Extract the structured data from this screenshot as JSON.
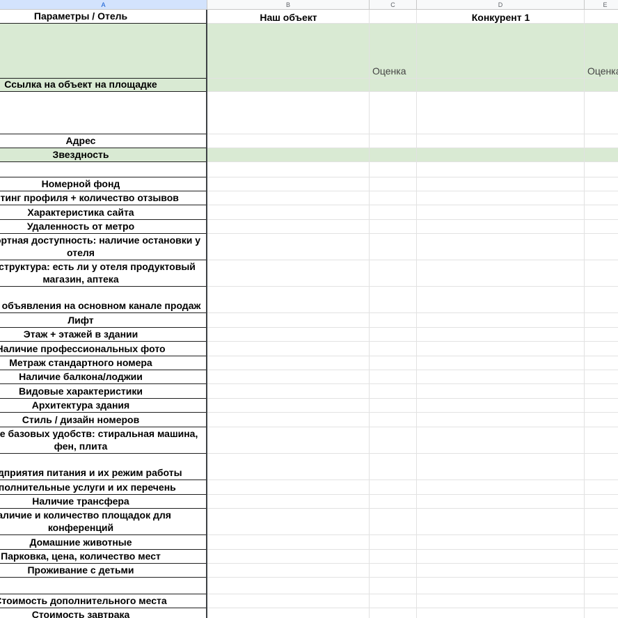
{
  "columns": [
    "A",
    "B",
    "C",
    "D",
    "E"
  ],
  "headers": {
    "our": "Наш объект",
    "competitor1": "Конкурент 1"
  },
  "score_label": "Оценка",
  "params": [
    {
      "label": "Параметры / Отель",
      "h": 20,
      "green": false,
      "align": "center"
    },
    {
      "label": "",
      "h": 79,
      "green": true
    },
    {
      "label": "Ссылка на объект на площадке",
      "h": 19,
      "green": true
    },
    {
      "label": "",
      "h": 61,
      "green": false
    },
    {
      "label": "Адрес",
      "h": 20,
      "green": false
    },
    {
      "label": "Звездность",
      "h": 20,
      "green": true
    },
    {
      "label": "",
      "h": 22,
      "green": false
    },
    {
      "label": "Номерной фонд",
      "h": 20,
      "green": false
    },
    {
      "label": "Рейтинг профиля + количество отзывов",
      "h": 20,
      "green": false
    },
    {
      "label": "Характеристика сайта",
      "h": 21,
      "green": false
    },
    {
      "label": "Удаленность от метро",
      "h": 20,
      "green": false
    },
    {
      "label": "Транспортная доступность: наличие остановки у отеля",
      "h": 38,
      "green": false
    },
    {
      "label": "Инфраструктура: есть ли у отеля продуктовый магазин, аптека",
      "h": 38,
      "green": false
    },
    {
      "label": "Рейтинг объявления на основном канале продаж",
      "h": 38,
      "green": false
    },
    {
      "label": "Лифт",
      "h": 21,
      "green": false
    },
    {
      "label": "Этаж + этажей в здании",
      "h": 20,
      "green": false
    },
    {
      "label": "Наличие профессиональных фото",
      "h": 21,
      "green": false
    },
    {
      "label": "Метраж стандартного номера",
      "h": 20,
      "green": false
    },
    {
      "label": "Наличие балкона/лоджии",
      "h": 20,
      "green": false
    },
    {
      "label": "Видовые характеристики",
      "h": 21,
      "green": false
    },
    {
      "label": "Архитектура здания",
      "h": 20,
      "green": false
    },
    {
      "label": "Стиль / дизайн номеров",
      "h": 21,
      "green": false
    },
    {
      "label": "Наличие базовых удобств: стиральная машина, фен, плита",
      "h": 38,
      "green": false
    },
    {
      "label": "Предприятия питания и их режим работы",
      "h": 38,
      "green": false
    },
    {
      "label": "Дополнительные услуги и их перечень",
      "h": 21,
      "green": false
    },
    {
      "label": "Наличие трансфера",
      "h": 20,
      "green": false
    },
    {
      "label": "Наличие и количество площадок для конференций",
      "h": 38,
      "green": false
    },
    {
      "label": "Домашние животные",
      "h": 21,
      "green": false
    },
    {
      "label": "Парковка, цена, количество мест",
      "h": 20,
      "green": false
    },
    {
      "label": "Проживание с детьми",
      "h": 20,
      "green": false
    },
    {
      "label": "",
      "h": 24,
      "green": false
    },
    {
      "label": "Стоимость дополнительного места",
      "h": 20,
      "green": false
    },
    {
      "label": "Стоимость завтрака",
      "h": 20,
      "green": false
    }
  ]
}
